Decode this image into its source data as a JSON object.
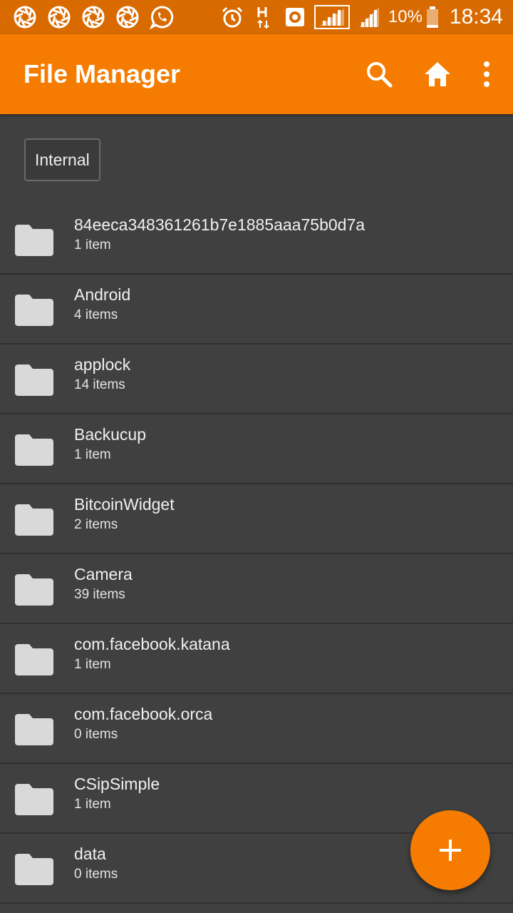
{
  "status_bar": {
    "icons_left": [
      "aperture-icon",
      "aperture-icon",
      "aperture-icon",
      "aperture-icon",
      "whatsapp-icon"
    ],
    "icons_right": [
      "alarm-clock-icon",
      "h-network-icon",
      "vpn-icon",
      "signal-bars-icon",
      "signal-bars-icon"
    ],
    "battery_text": "10%",
    "time": "18:34"
  },
  "app_bar": {
    "title": "File Manager",
    "background": "#f57c00",
    "actions": [
      "search-icon",
      "home-icon",
      "more-vert-icon"
    ]
  },
  "breadcrumb": {
    "label": "Internal"
  },
  "files": [
    {
      "name": "84eeca348361261b7e1885aaa75b0d7a",
      "count": "1 item"
    },
    {
      "name": "Android",
      "count": "4 items"
    },
    {
      "name": "applock",
      "count": "14 items"
    },
    {
      "name": "Backucup",
      "count": "1 item"
    },
    {
      "name": "BitcoinWidget",
      "count": "2 items"
    },
    {
      "name": "Camera",
      "count": "39 items"
    },
    {
      "name": "com.facebook.katana",
      "count": "1 item"
    },
    {
      "name": "com.facebook.orca",
      "count": "0 items"
    },
    {
      "name": "CSipSimple",
      "count": "1 item"
    },
    {
      "name": "data",
      "count": "0 items"
    }
  ],
  "fab": {
    "icon": "plus-icon",
    "color": "#f57c00"
  }
}
